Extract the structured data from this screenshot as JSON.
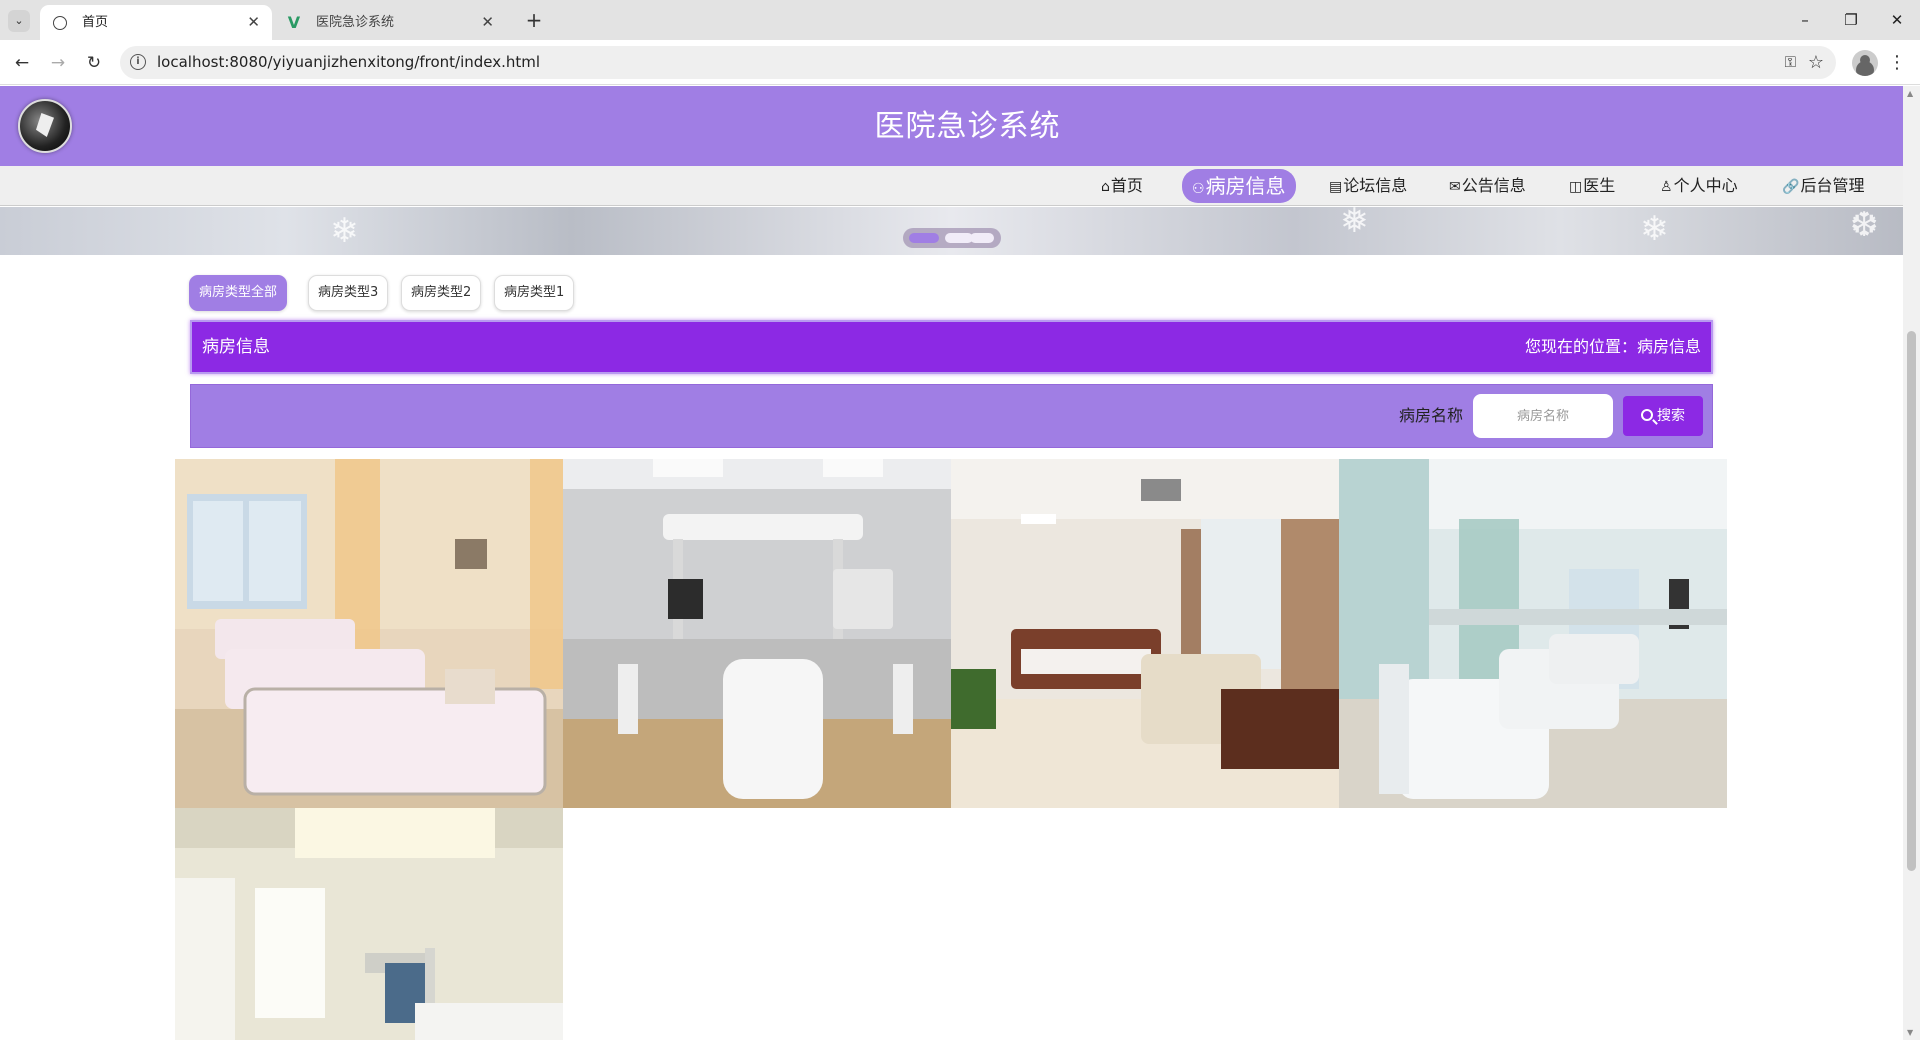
{
  "browser": {
    "tabs": [
      {
        "title": "首页",
        "favicon": "globe-icon",
        "active": true
      },
      {
        "title": "医院急诊系统",
        "favicon": "vue-icon",
        "active": false
      }
    ],
    "url": "localhost:8080/yiyuanjizhenxitong/front/index.html"
  },
  "site": {
    "title": "医院急诊系统",
    "brand_color": "#a07ee4",
    "accent_color": "#8c29e4"
  },
  "nav": {
    "items": [
      {
        "label": "首页",
        "icon": "home-icon",
        "glyph": "⌂"
      },
      {
        "label": "病房信息",
        "icon": "ward-icon",
        "glyph": "⚇",
        "active": true
      },
      {
        "label": "论坛信息",
        "icon": "forum-icon",
        "glyph": "▤"
      },
      {
        "label": "公告信息",
        "icon": "mail-icon",
        "glyph": "✉"
      },
      {
        "label": "医生",
        "icon": "doctor-icon",
        "glyph": "◫"
      },
      {
        "label": "个人中心",
        "icon": "user-icon",
        "glyph": "♙"
      },
      {
        "label": "后台管理",
        "icon": "link-icon",
        "glyph": "🔗"
      }
    ]
  },
  "carousel": {
    "count": 3,
    "active_index": 0
  },
  "filters": [
    {
      "label": "病房类型全部",
      "active": true
    },
    {
      "label": "病房类型3",
      "active": false
    },
    {
      "label": "病房类型2",
      "active": false
    },
    {
      "label": "病房类型1",
      "active": false
    }
  ],
  "section": {
    "title": "病房信息",
    "breadcrumb": "您现在的位置：病房信息"
  },
  "search": {
    "label": "病房名称",
    "placeholder": "病房名称",
    "button": "搜索"
  },
  "rooms": [
    {
      "scene": "ward-beds-warm"
    },
    {
      "scene": "icu-bed"
    },
    {
      "scene": "vip-suite"
    },
    {
      "scene": "ward-beds-green"
    },
    {
      "scene": "single-room-bright"
    }
  ]
}
